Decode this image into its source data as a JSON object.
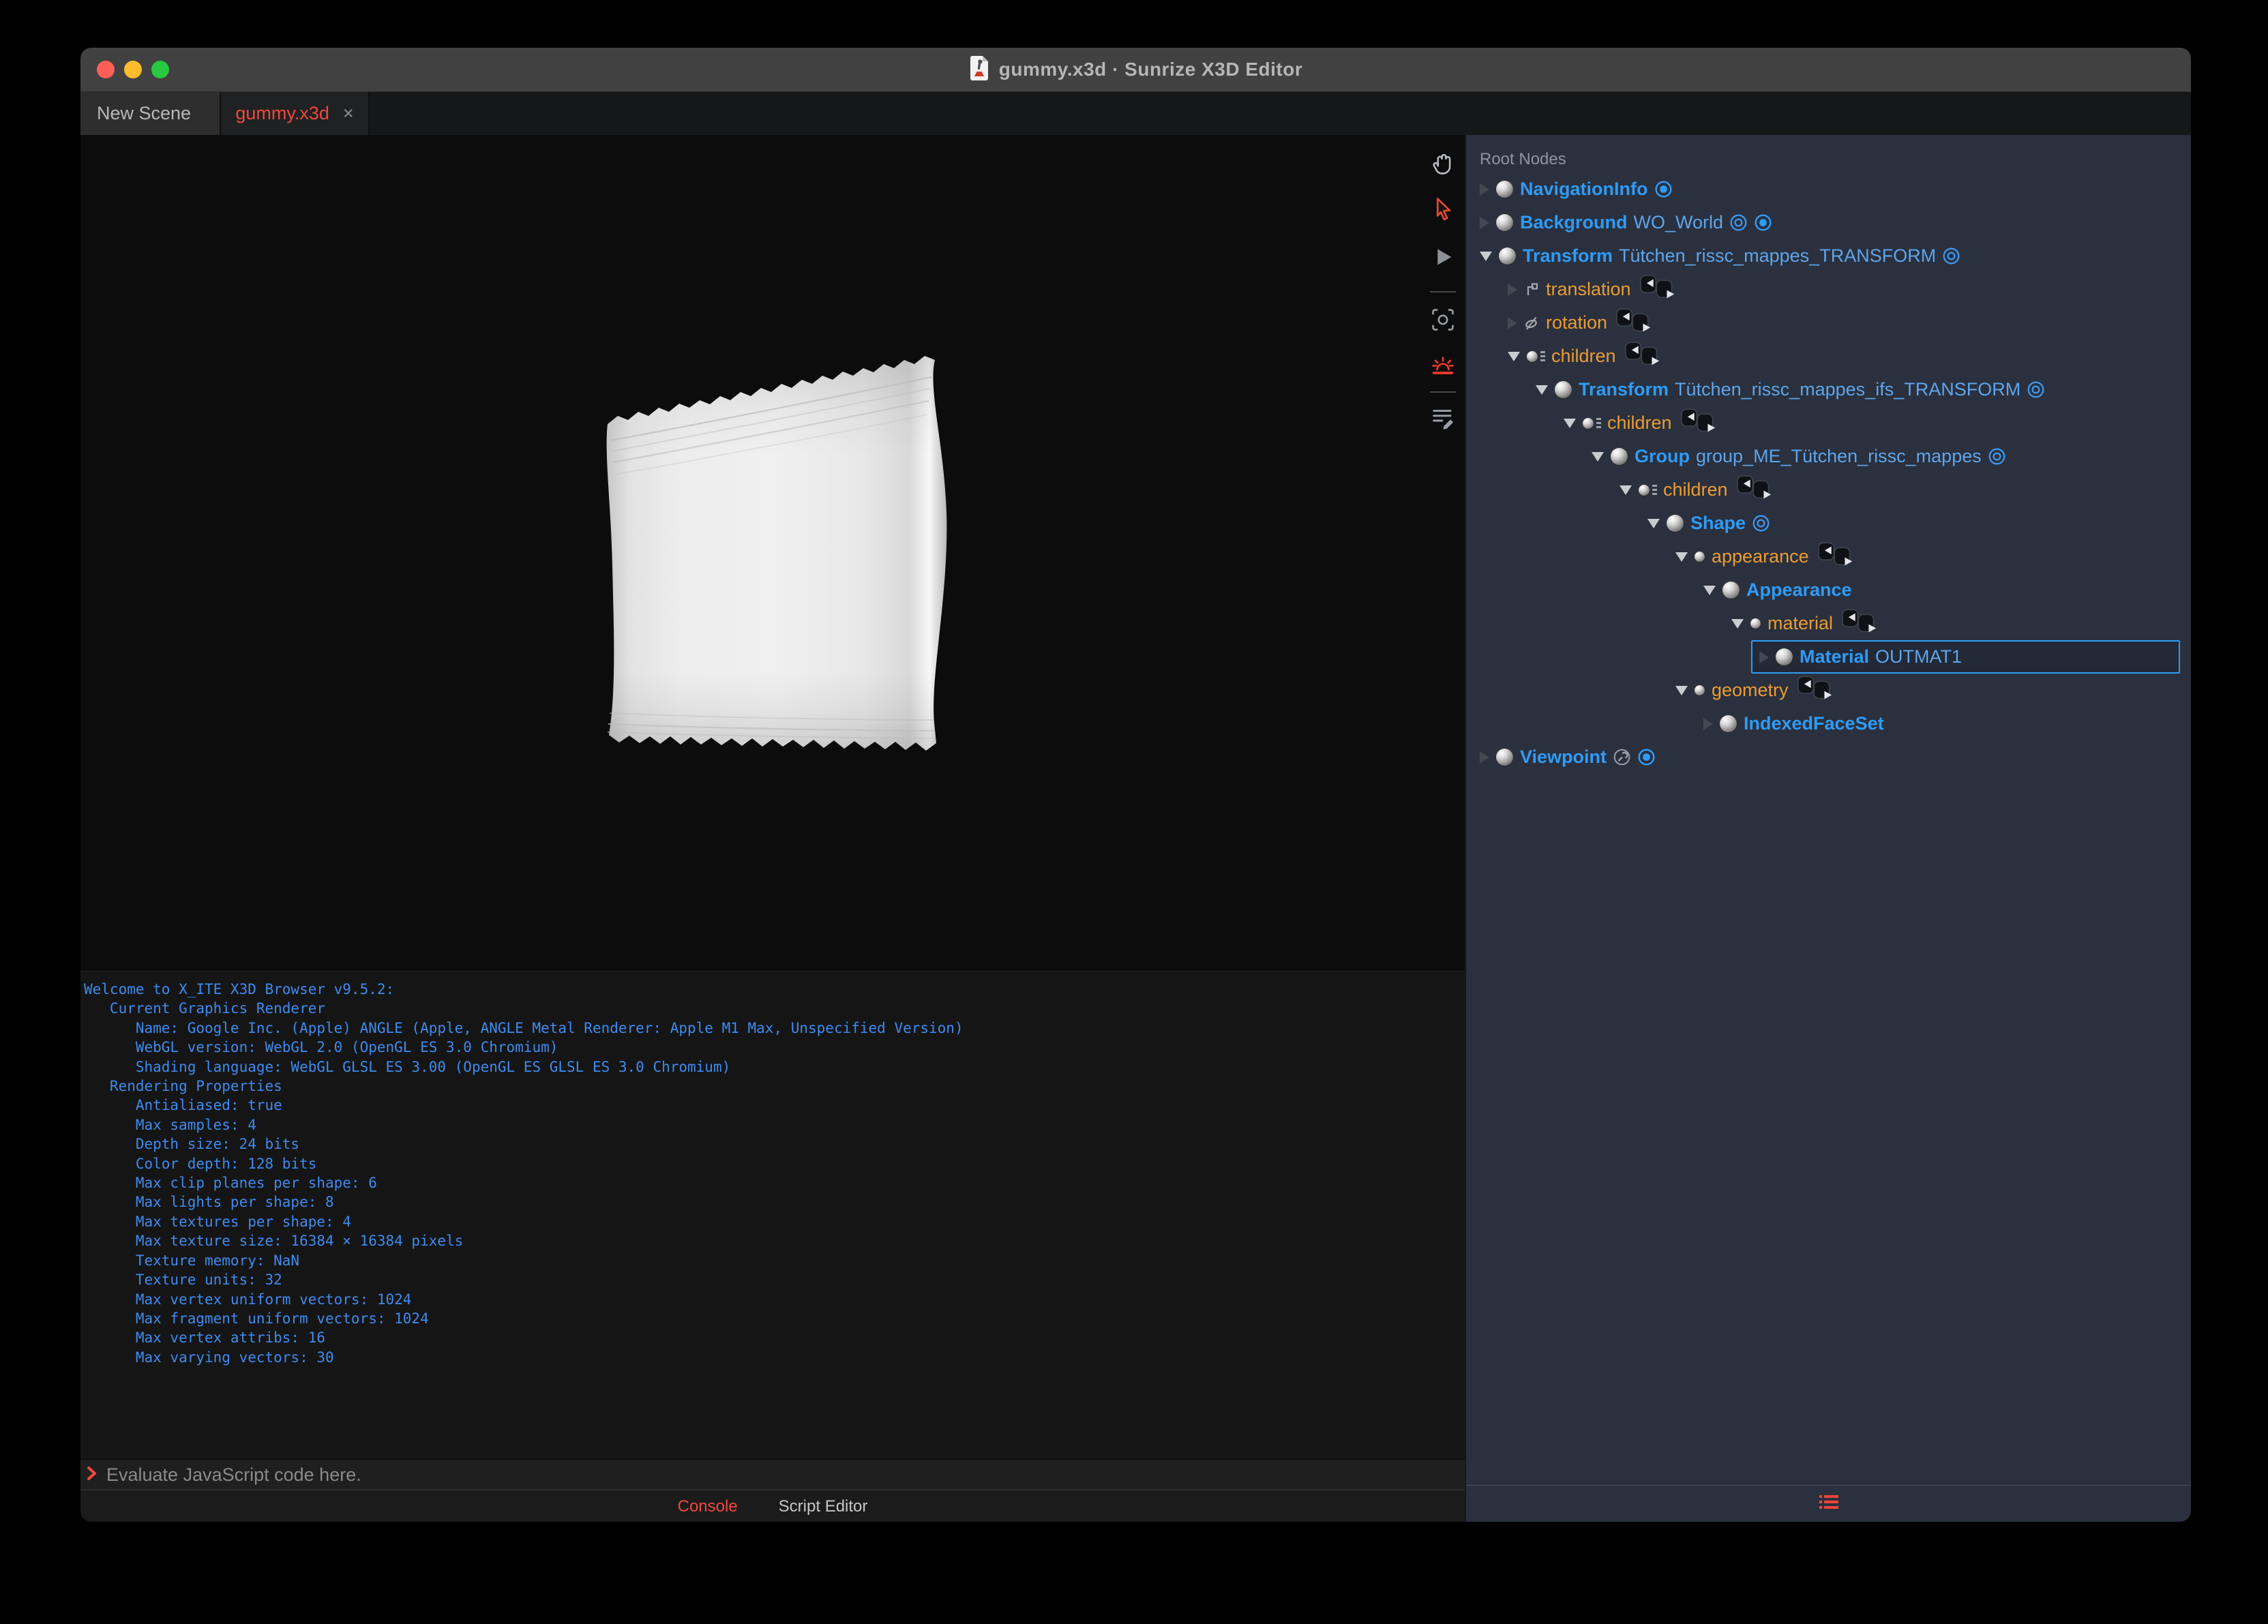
{
  "window": {
    "title": "gummy.x3d · Sunrize X3D Editor",
    "traffic_lights": {
      "close": "#ff5f57",
      "minimize": "#febc2e",
      "zoom": "#28c840"
    }
  },
  "tabs": [
    {
      "label": "New Scene",
      "active": false
    },
    {
      "label": "gummy.x3d",
      "close_label": "×",
      "active": true
    }
  ],
  "viewport_toolbar": [
    {
      "icon": "pan-hand-icon",
      "active": false
    },
    {
      "icon": "select-arrow-icon",
      "active": true
    },
    {
      "icon": "play-icon",
      "active": false
    },
    {
      "icon": "divider"
    },
    {
      "icon": "screenshot-icon",
      "active": false
    },
    {
      "icon": "sunrise-light-icon",
      "active": true
    },
    {
      "icon": "divider"
    },
    {
      "icon": "script-edit-icon",
      "active": false
    }
  ],
  "console_toolbar": [
    {
      "icon": "clear-console-icon"
    },
    {
      "icon": "delete-messages-icon"
    },
    {
      "icon": "divider"
    }
  ],
  "outline": {
    "header": "Root Nodes",
    "rows": [
      {
        "level": 0,
        "expanded": false,
        "kind": "node",
        "label": "NavigationInfo",
        "def": "",
        "icons": [
          "bind"
        ]
      },
      {
        "level": 0,
        "expanded": false,
        "kind": "node",
        "label": "Background",
        "def": "WO_World",
        "icons": [
          "eye",
          "bind"
        ]
      },
      {
        "level": 0,
        "expanded": true,
        "kind": "node",
        "label": "Transform",
        "def": "Tütchen_rissc_mappes_TRANSFORM",
        "icons": [
          "eye"
        ]
      },
      {
        "level": 1,
        "expanded": false,
        "kind": "field",
        "ficon": "axis",
        "label": "translation",
        "icons": [
          "route"
        ]
      },
      {
        "level": 1,
        "expanded": false,
        "kind": "field",
        "ficon": "rotate",
        "label": "rotation",
        "icons": [
          "route"
        ]
      },
      {
        "level": 1,
        "expanded": true,
        "kind": "field",
        "ficon": "nodes",
        "label": "children",
        "icons": [
          "route"
        ]
      },
      {
        "level": 2,
        "expanded": true,
        "kind": "node",
        "label": "Transform",
        "def": "Tütchen_rissc_mappes_ifs_TRANSFORM",
        "icons": [
          "eye"
        ]
      },
      {
        "level": 3,
        "expanded": true,
        "kind": "field",
        "ficon": "nodes",
        "label": "children",
        "icons": [
          "route"
        ]
      },
      {
        "level": 4,
        "expanded": true,
        "kind": "node",
        "label": "Group",
        "def": "group_ME_Tütchen_rissc_mappes",
        "icons": [
          "eye"
        ]
      },
      {
        "level": 5,
        "expanded": true,
        "kind": "field",
        "ficon": "nodes",
        "label": "children",
        "icons": [
          "route"
        ]
      },
      {
        "level": 6,
        "expanded": true,
        "kind": "node",
        "label": "Shape",
        "def": "",
        "icons": [
          "eye"
        ]
      },
      {
        "level": 7,
        "expanded": true,
        "kind": "field",
        "ficon": "node",
        "label": "appearance",
        "icons": [
          "route"
        ]
      },
      {
        "level": 8,
        "expanded": true,
        "kind": "node",
        "label": "Appearance",
        "def": "",
        "icons": []
      },
      {
        "level": 9,
        "expanded": true,
        "kind": "field",
        "ficon": "node",
        "label": "material",
        "icons": [
          "route"
        ]
      },
      {
        "level": 10,
        "expanded": false,
        "kind": "node",
        "label": "Material",
        "def": "OUTMAT1",
        "icons": [],
        "selected": true
      },
      {
        "level": 7,
        "expanded": true,
        "kind": "field",
        "ficon": "node",
        "label": "geometry",
        "icons": [
          "route"
        ]
      },
      {
        "level": 8,
        "expanded": false,
        "kind": "node",
        "label": "IndexedFaceSet",
        "def": "",
        "icons": []
      },
      {
        "level": 0,
        "expanded": false,
        "kind": "node",
        "label": "Viewpoint",
        "def": "",
        "icons": [
          "wrench",
          "bind"
        ]
      }
    ]
  },
  "console": {
    "lines": [
      "Welcome to X_ITE X3D Browser v9.5.2:",
      "   Current Graphics Renderer",
      "      Name: Google Inc. (Apple) ANGLE (Apple, ANGLE Metal Renderer: Apple M1 Max, Unspecified Version)",
      "      WebGL version: WebGL 2.0 (OpenGL ES 3.0 Chromium)",
      "      Shading language: WebGL GLSL ES 3.00 (OpenGL ES GLSL ES 3.0 Chromium)",
      "   Rendering Properties",
      "      Antialiased: true",
      "      Max samples: 4",
      "      Depth size: 24 bits",
      "      Color depth: 128 bits",
      "      Max clip planes per shape: 6",
      "      Max lights per shape: 8",
      "      Max textures per shape: 4",
      "      Max texture size: 16384 × 16384 pixels",
      "      Texture memory: NaN",
      "      Texture units: 32",
      "      Max vertex uniform vectors: 1024",
      "      Max fragment uniform vectors: 1024",
      "      Max vertex attribs: 16",
      "      Max varying vectors: 30"
    ],
    "prompt": "❯",
    "input_placeholder": "Evaluate JavaScript code here.",
    "tabs": [
      {
        "label": "Console",
        "active": true
      },
      {
        "label": "Script Editor",
        "active": false
      }
    ]
  },
  "colors": {
    "accent_blue": "#2e9bf7",
    "def_blue": "#5ea5ec",
    "field_orange": "#eb9c34",
    "accent_red": "#f0483e",
    "console_text": "#3e8bf0",
    "panel_bg": "#2a303d",
    "titlebar_bg": "#414141"
  }
}
